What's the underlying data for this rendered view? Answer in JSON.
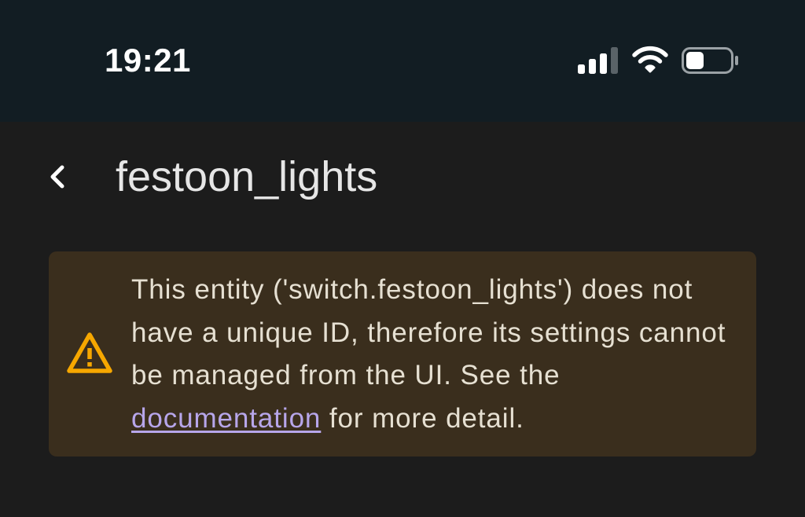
{
  "status_bar": {
    "time": "19:21",
    "signal_icon": "cellular-signal-icon",
    "wifi_icon": "wifi-icon",
    "battery_icon": "battery-icon",
    "battery_level": 0.3
  },
  "app_bar": {
    "back_icon": "chevron-left-icon",
    "title": "festoon_lights"
  },
  "alert": {
    "icon": "warning-triangle-icon",
    "icon_color": "#f6a700",
    "background_color": "#3a2e1d",
    "text_before_link": "This entity ('switch.festoon_lights') does not have a unique ID, therefore its settings cannot be managed from the UI. See the ",
    "link_text": "documentation",
    "link_color": "#b7a6ea",
    "text_after_link": " for more detail."
  }
}
